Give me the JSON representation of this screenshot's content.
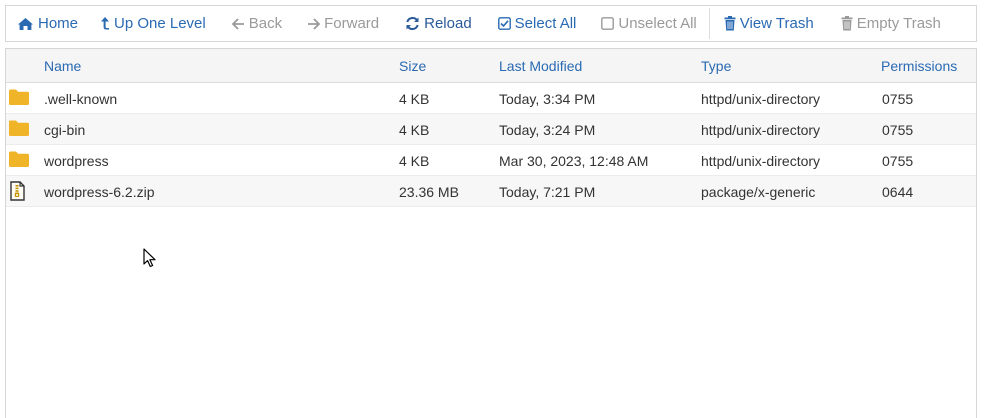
{
  "toolbar": {
    "home": "Home",
    "up_one_level": "Up One Level",
    "back": "Back",
    "forward": "Forward",
    "reload": "Reload",
    "select_all": "Select All",
    "unselect_all": "Unselect All",
    "view_trash": "View Trash",
    "empty_trash": "Empty Trash"
  },
  "columns": {
    "name": "Name",
    "size": "Size",
    "last_modified": "Last Modified",
    "type": "Type",
    "permissions": "Permissions"
  },
  "files": [
    {
      "icon": "folder-icon",
      "name": ".well-known",
      "size": "4 KB",
      "modified": "Today, 3:34 PM",
      "type": "httpd/unix-directory",
      "perms": "0755"
    },
    {
      "icon": "folder-icon",
      "name": "cgi-bin",
      "size": "4 KB",
      "modified": "Today, 3:24 PM",
      "type": "httpd/unix-directory",
      "perms": "0755"
    },
    {
      "icon": "folder-icon",
      "name": "wordpress",
      "size": "4 KB",
      "modified": "Mar 30, 2023, 12:48 AM",
      "type": "httpd/unix-directory",
      "perms": "0755"
    },
    {
      "icon": "zip-file-icon",
      "name": "wordpress-6.2.zip",
      "size": "23.36 MB",
      "modified": "Today, 7:21 PM",
      "type": "package/x-generic",
      "perms": "0644"
    }
  ],
  "colors": {
    "link": "#2a6ab3",
    "disabled": "#9a9a9a",
    "folder": "#f0b429"
  }
}
